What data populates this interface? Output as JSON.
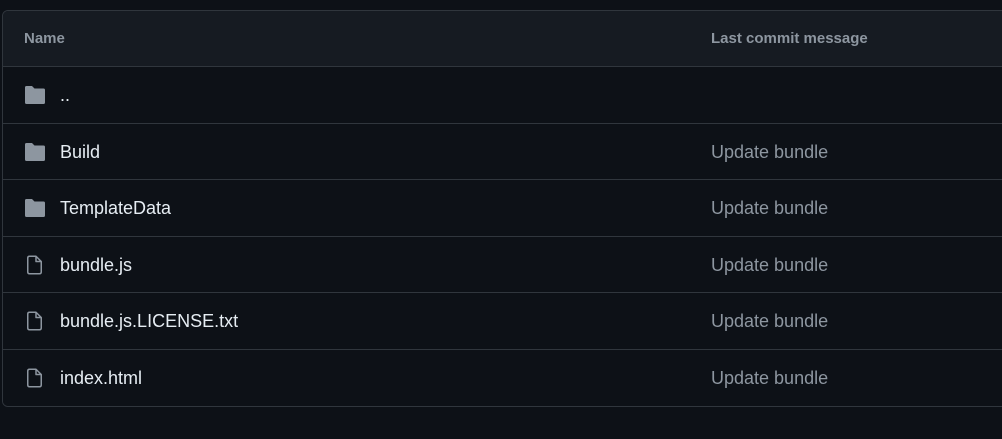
{
  "table": {
    "headers": {
      "name": "Name",
      "last_commit_message": "Last commit message"
    },
    "rows": [
      {
        "type": "folder",
        "icon": "folder-icon",
        "name": "..",
        "message": ""
      },
      {
        "type": "folder",
        "icon": "folder-icon",
        "name": "Build",
        "message": "Update bundle"
      },
      {
        "type": "folder",
        "icon": "folder-icon",
        "name": "TemplateData",
        "message": "Update bundle"
      },
      {
        "type": "file",
        "icon": "file-icon",
        "name": "bundle.js",
        "message": "Update bundle"
      },
      {
        "type": "file",
        "icon": "file-icon",
        "name": "bundle.js.LICENSE.txt",
        "message": "Update bundle"
      },
      {
        "type": "file",
        "icon": "file-icon",
        "name": "index.html",
        "message": "Update bundle"
      }
    ]
  },
  "colors": {
    "background": "#0d1117",
    "header_background": "#161b22",
    "border": "#30363d",
    "primary_text": "#e6edf3",
    "secondary_text": "#8d96a0",
    "folder_icon": "#8d96a0"
  }
}
